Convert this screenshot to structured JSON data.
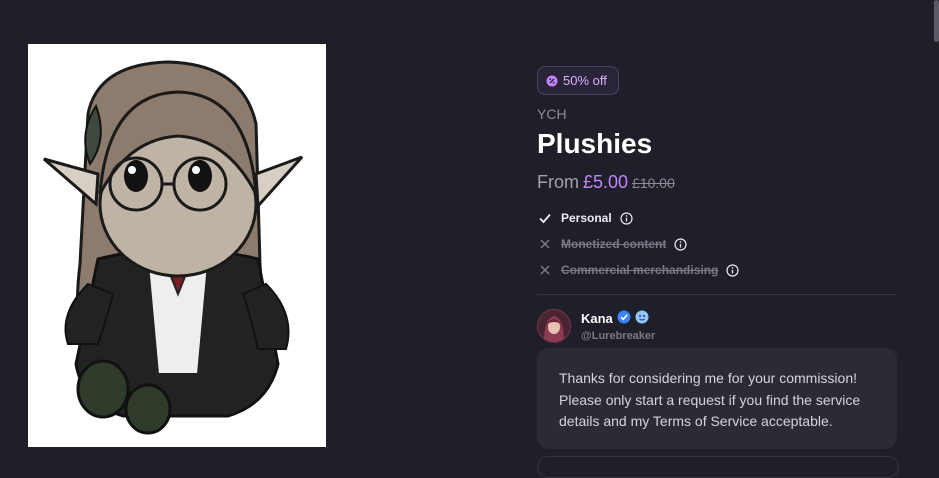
{
  "listing": {
    "discount_label": "50% off",
    "category": "YCH",
    "title": "Plushies",
    "price_prefix": "From",
    "price_current": "£5.00",
    "price_original": "£10.00",
    "usage_rights": [
      {
        "label": "Personal",
        "allowed": true
      },
      {
        "label": "Monetized content",
        "allowed": false
      },
      {
        "label": "Commercial merchandising",
        "allowed": false
      }
    ]
  },
  "seller": {
    "name": "Kana",
    "handle": "@Lurebreaker",
    "badges": [
      "verified-icon",
      "emoji-badge-icon"
    ],
    "message": "Thanks for considering me for your commission! Please only start a request if you find the service details and my Terms of Service acceptable."
  },
  "icons": {
    "discount": "discount-icon",
    "allowed": "check-icon",
    "denied": "x-icon",
    "info": "info-icon"
  },
  "colors": {
    "background": "#1f1f2a",
    "accent": "#c084fc",
    "card": "#2b2b36"
  }
}
